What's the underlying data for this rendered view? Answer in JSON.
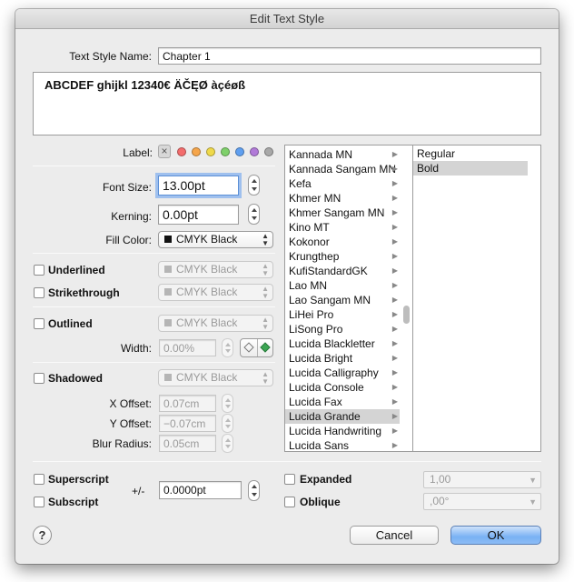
{
  "window": {
    "title": "Edit Text Style"
  },
  "style_name": {
    "label": "Text Style Name:",
    "value": "Chapter 1"
  },
  "preview_text": "ABCDEF ghijkl 12340€ ÄČĘØ àçéøß",
  "label": {
    "text": "Label:",
    "colors": [
      "#f36c6c",
      "#f5a54a",
      "#efd94a",
      "#7ed06a",
      "#5f9ff0",
      "#b17ad8",
      "#a8a8a8"
    ]
  },
  "font_size": {
    "label": "Font Size:",
    "value": "13.00pt"
  },
  "kerning": {
    "label": "Kerning:",
    "value": "0.00pt"
  },
  "fill_color": {
    "label": "Fill Color:",
    "value": "CMYK Black",
    "swatch": "#111111"
  },
  "underlined": {
    "label": "Underlined",
    "color": "CMYK Black"
  },
  "strikethrough": {
    "label": "Strikethrough",
    "color": "CMYK Black"
  },
  "outlined": {
    "label": "Outlined",
    "color": "CMYK Black",
    "width_label": "Width:",
    "width_value": "0.00%"
  },
  "shadowed": {
    "label": "Shadowed",
    "color": "CMYK Black",
    "x_label": "X Offset:",
    "x_value": "0.07cm",
    "y_label": "Y Offset:",
    "y_value": "−0.07cm",
    "blur_label": "Blur Radius:",
    "blur_value": "0.05cm"
  },
  "fonts": [
    "Kannada MN",
    "Kannada Sangam MN",
    "Kefa",
    "Khmer MN",
    "Khmer Sangam MN",
    "Kino MT",
    "Kokonor",
    "Krungthep",
    "KufiStandardGK",
    "Lao MN",
    "Lao Sangam MN",
    "LiHei Pro",
    "LiSong Pro",
    "Lucida Blackletter",
    "Lucida Bright",
    "Lucida Calligraphy",
    "Lucida Console",
    "Lucida Fax",
    "Lucida Grande",
    "Lucida Handwriting",
    "Lucida Sans"
  ],
  "selected_font": "Lucida Grande",
  "styles": [
    "Regular",
    "Bold"
  ],
  "selected_style": "Bold",
  "superscript": {
    "label": "Superscript"
  },
  "subscript": {
    "label": "Subscript"
  },
  "baseline": {
    "label": "+/-",
    "value": "0.0000pt"
  },
  "expanded": {
    "label": "Expanded",
    "value": "1,00"
  },
  "oblique": {
    "label": "Oblique",
    "value": ",00°"
  },
  "buttons": {
    "help": "?",
    "cancel": "Cancel",
    "ok": "OK"
  }
}
